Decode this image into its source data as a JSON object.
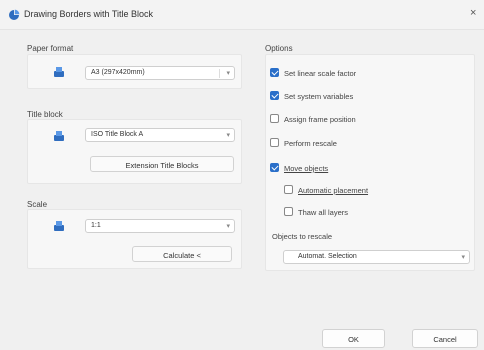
{
  "window": {
    "title": "Drawing Borders with Title Block",
    "close": "×"
  },
  "paper_format": {
    "label": "Paper format",
    "value": "A3 (297x420mm)",
    "icon": "paper-format-icon"
  },
  "title_block": {
    "label": "Title block",
    "value": "ISO Title Block A",
    "button": "Extension Title Blocks",
    "icon": "title-block-icon"
  },
  "scale": {
    "label": "Scale",
    "value": "1:1",
    "button": "Calculate <",
    "icon": "scale-icon"
  },
  "options": {
    "label": "Options",
    "items": [
      {
        "label": "Set linear scale factor",
        "checked": true
      },
      {
        "label": "Set system variables",
        "checked": true
      },
      {
        "label": "Assign frame position",
        "checked": false
      },
      {
        "label": "Perform rescale",
        "checked": false
      },
      {
        "label": "Move objects",
        "checked": true
      },
      {
        "label": "Automatic placement",
        "checked": false
      },
      {
        "label": "Thaw all layers",
        "checked": false
      }
    ],
    "rescale_label": "Objects to rescale",
    "rescale_value": "Automat. Selection"
  },
  "footer": {
    "ok": "OK",
    "cancel": "Cancel"
  },
  "colors": {
    "accent": "#2a6fc9",
    "icon_blue": "#2f6dbf"
  }
}
